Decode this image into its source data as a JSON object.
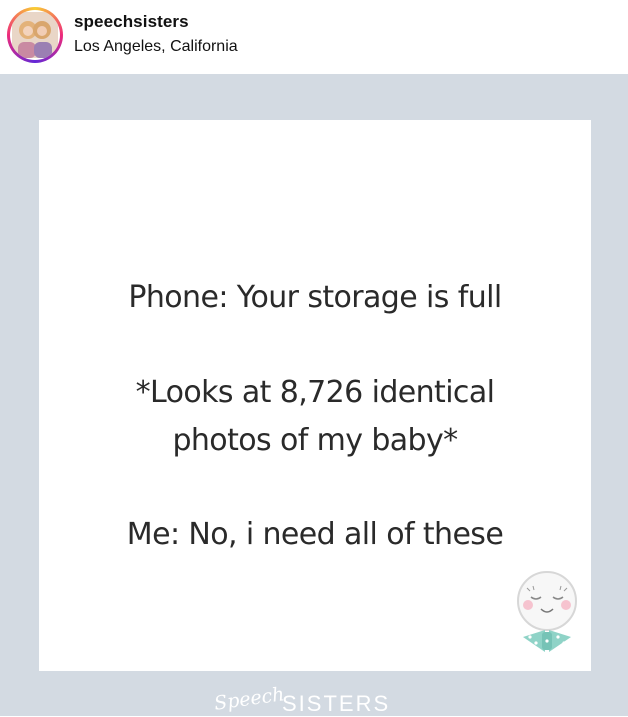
{
  "header": {
    "username": "speechsisters",
    "location": "Los Angeles, California"
  },
  "post": {
    "lines": [
      "Phone: Your storage is full",
      "*Looks at 8,726 identical",
      "photos of my baby*",
      "Me: No, i need all of these"
    ],
    "footer": {
      "script_text": "Speech",
      "brand_text": "SISTERS"
    }
  },
  "colors": {
    "frame_background": "#d3dae2",
    "card_background": "#ffffff",
    "text": "#2a2a2a",
    "mascot_bowtie": "#8fd3c7"
  }
}
